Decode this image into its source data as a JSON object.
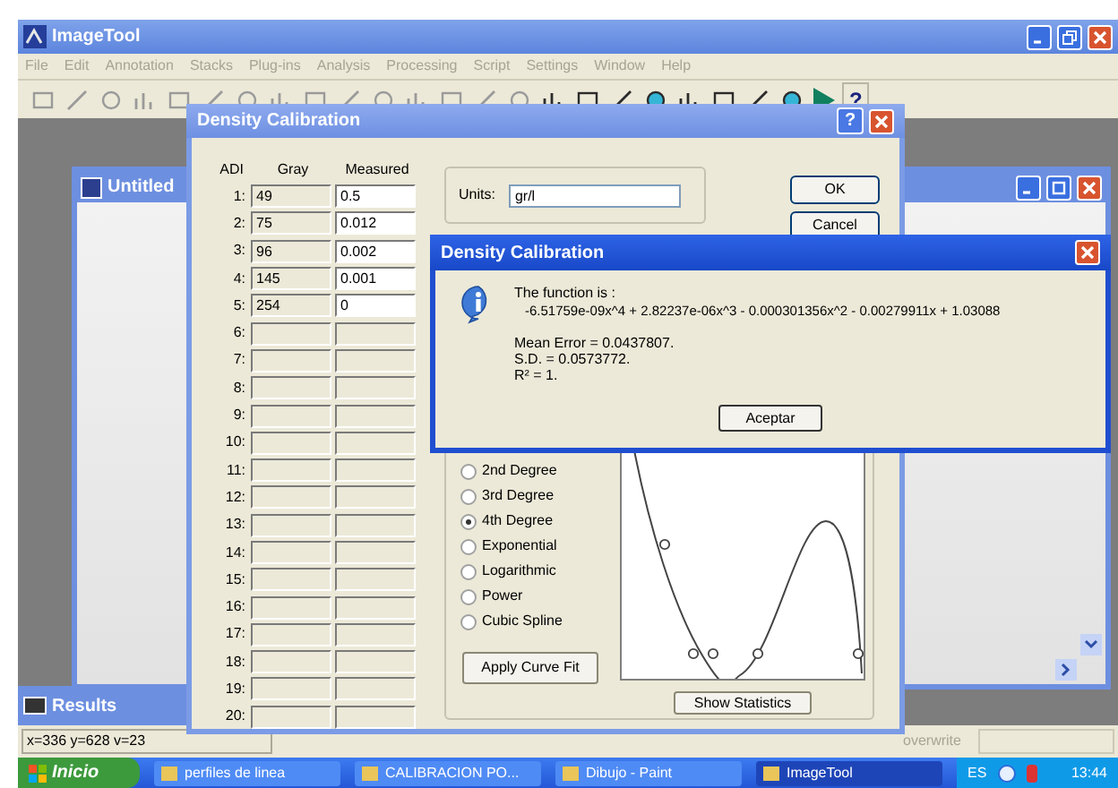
{
  "app": {
    "title": "ImageTool",
    "help_tool": "?",
    "menu": [
      {
        "label": "File",
        "disabled": true
      },
      {
        "label": "Edit",
        "disabled": true
      },
      {
        "label": "Annotation",
        "disabled": true
      },
      {
        "label": "Stacks",
        "disabled": true
      },
      {
        "label": "Plug-ins",
        "disabled": true
      },
      {
        "label": "Analysis",
        "disabled": true
      },
      {
        "label": "Processing",
        "disabled": true
      },
      {
        "label": "Script",
        "disabled": true
      },
      {
        "label": "Settings",
        "disabled": true
      },
      {
        "label": "Window",
        "disabled": true
      },
      {
        "label": "Help",
        "disabled": true
      }
    ]
  },
  "document_window": {
    "title": "Untitled"
  },
  "results_window": {
    "title": "Results"
  },
  "status_bar": {
    "coordinates": "x=336 y=628 v=23",
    "mode": "overwrite"
  },
  "calibration": {
    "title": "Density Calibration",
    "help": "?",
    "columns": [
      "ADI",
      "Gray",
      "Measured"
    ],
    "rows": [
      {
        "index": "1:",
        "gray": "49",
        "measured": "0.5",
        "enabled": true
      },
      {
        "index": "2:",
        "gray": "75",
        "measured": "0.012",
        "enabled": true
      },
      {
        "index": "3:",
        "gray": "96",
        "measured": "0.002",
        "enabled": true
      },
      {
        "index": "4:",
        "gray": "145",
        "measured": "0.001",
        "enabled": true
      },
      {
        "index": "5:",
        "gray": "254",
        "measured": "0",
        "enabled": true
      },
      {
        "index": "6:",
        "gray": "",
        "measured": "",
        "enabled": false
      },
      {
        "index": "7:",
        "gray": "",
        "measured": "",
        "enabled": false
      },
      {
        "index": "8:",
        "gray": "",
        "measured": "",
        "enabled": false
      },
      {
        "index": "9:",
        "gray": "",
        "measured": "",
        "enabled": false
      },
      {
        "index": "10:",
        "gray": "",
        "measured": "",
        "enabled": false
      },
      {
        "index": "11:",
        "gray": "",
        "measured": "",
        "enabled": false
      },
      {
        "index": "12:",
        "gray": "",
        "measured": "",
        "enabled": false
      },
      {
        "index": "13:",
        "gray": "",
        "measured": "",
        "enabled": false
      },
      {
        "index": "14:",
        "gray": "",
        "measured": "",
        "enabled": false
      },
      {
        "index": "15:",
        "gray": "",
        "measured": "",
        "enabled": false
      },
      {
        "index": "16:",
        "gray": "",
        "measured": "",
        "enabled": false
      },
      {
        "index": "17:",
        "gray": "",
        "measured": "",
        "enabled": false
      },
      {
        "index": "18:",
        "gray": "",
        "measured": "",
        "enabled": false
      },
      {
        "index": "19:",
        "gray": "",
        "measured": "",
        "enabled": false
      },
      {
        "index": "20:",
        "gray": "",
        "measured": "",
        "enabled": false
      }
    ],
    "units_label": "Units:",
    "units_value": "gr/l",
    "ok": "OK",
    "cancel": "Cancel",
    "fits": [
      {
        "label": "2nd Degree",
        "selected": false
      },
      {
        "label": "3rd Degree",
        "selected": false
      },
      {
        "label": "4th Degree",
        "selected": true
      },
      {
        "label": "Exponential",
        "selected": false
      },
      {
        "label": "Logarithmic",
        "selected": false
      },
      {
        "label": "Power",
        "selected": false
      },
      {
        "label": "Cubic Spline",
        "selected": false
      }
    ],
    "apply": "Apply Curve Fit",
    "show_stats": "Show Statistics"
  },
  "message": {
    "title": "Density Calibration",
    "heading": "The function is :",
    "function": "-6.51759e-09x^4 + 2.82237e-06x^3 - 0.000301356x^2 - 0.00279911x + 1.03088",
    "stats": [
      "Mean Error = 0.0437807.",
      "S.D. = 0.0573772.",
      "R² = 1."
    ],
    "button": "Aceptar"
  },
  "taskbar": {
    "start": "Inicio",
    "tasks": [
      {
        "label": "perfiles de linea",
        "active": false
      },
      {
        "label": "CALIBRACION PO...",
        "active": false
      },
      {
        "label": "Dibujo - Paint",
        "active": false
      },
      {
        "label": "ImageTool",
        "active": true
      }
    ],
    "language": "ES",
    "clock": "13:44"
  }
}
